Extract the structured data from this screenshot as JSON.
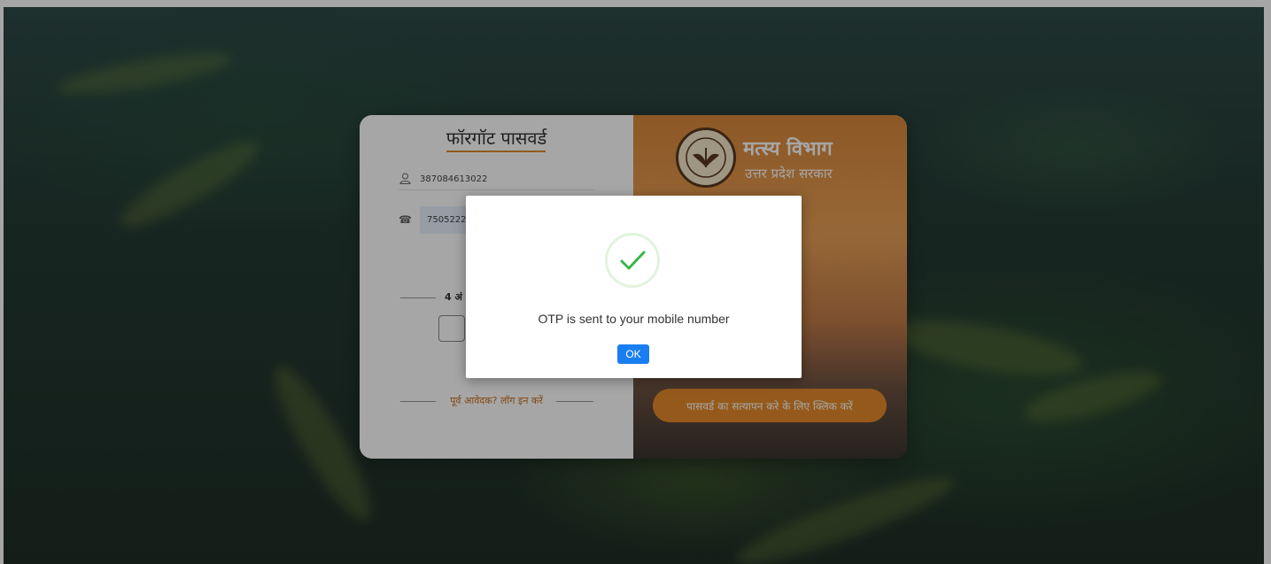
{
  "form": {
    "title": "फॉरगॉट पासवर्ड",
    "user_icon": "user-icon",
    "username_value": "387084613022",
    "phone_icon": "phone-icon",
    "mobile_value": "7505222520",
    "otp_label": "4 अं",
    "login_link": "पूर्व आवेदक? लॉग इन करें"
  },
  "brand": {
    "title": "मत्स्य विभाग",
    "subtitle": "उत्तर प्रदेश सरकार",
    "emblem_icon": "up-govt-emblem-icon",
    "verify_button": "पासवर्ड का सत्यापन करे के लिए क्लिक करें",
    "accent_color": "#e58a2a"
  },
  "dialog": {
    "icon": "success-check-icon",
    "message": "OTP is sent to your mobile number",
    "ok_label": "OK",
    "ok_color": "#1a7ef2",
    "check_color": "#3bb54a"
  }
}
